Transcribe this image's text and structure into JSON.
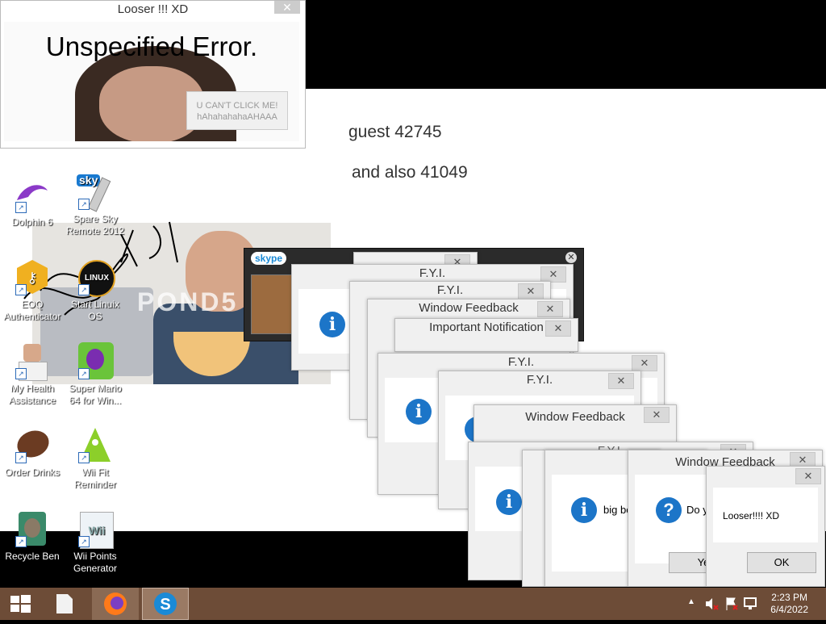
{
  "desktop": {
    "notes": [
      "guest 42745",
      "and also 41049"
    ],
    "photo_watermark": "POND5"
  },
  "looser_window": {
    "title": "Looser !!! XD",
    "close": "✕",
    "error_text": "Unspecified Error.",
    "button_label": "U CAN'T CLICK ME! hAhahahahaAHAAA"
  },
  "icons": [
    {
      "label": "Dolphin 6",
      "icon": "dolphin-icon"
    },
    {
      "label": "Spare Sky Remote 2012",
      "icon": "sky-remote-icon"
    },
    {
      "label": "EOQ Authenticator",
      "icon": "key-icon"
    },
    {
      "label": "Start Linuix OS",
      "icon": "linux-icon"
    },
    {
      "label": "My Health Assistance",
      "icon": "doctor-icon"
    },
    {
      "label": "Super Mario 64 for Win...",
      "icon": "mario-icon"
    },
    {
      "label": "Order Drinks",
      "icon": "coffee-bean-icon"
    },
    {
      "label": "Wii Fit Reminder",
      "icon": "wii-fit-icon"
    },
    {
      "label": "Recycle Ben",
      "icon": "recycle-bin-icon"
    },
    {
      "label": "Wii Points Generator",
      "icon": "wii-points-icon"
    }
  ],
  "skype": {
    "logo": "skype"
  },
  "dialogs": {
    "fyi_1": "F.Y.I.",
    "fyi_2": "F.Y.I.",
    "window_feedback_1": "Window Feedback",
    "important_notification": "Important Notification",
    "fyi_3": "F.Y.I.",
    "fyi_4": "F.Y.I.",
    "window_feedback_2": "Window Feedback",
    "fyi_partial": "F.Y.I.",
    "window_feedback_3": "Window Feedback",
    "big_text": "big bo",
    "question_text": "Do y",
    "question_button": "Ye",
    "final_message": "Looser!!!! XD",
    "ok_label": "OK"
  },
  "taskbar": {
    "time": "2:23 PM",
    "date": "6/4/2022",
    "tray_arrow": "▲"
  }
}
